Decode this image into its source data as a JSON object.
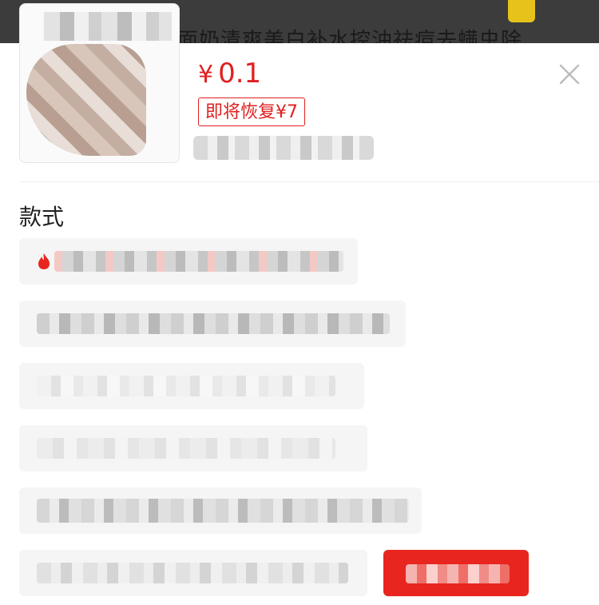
{
  "backdrop": {
    "title": "面奶清爽美白补水控油祛痘去螨虫除"
  },
  "product": {
    "price_currency": "¥",
    "price_value": "0.1",
    "restore_label": "即将恢复¥7"
  },
  "style_section": {
    "title": "款式"
  },
  "options": [
    {
      "hot": true
    },
    {
      "hot": false
    },
    {
      "hot": false
    },
    {
      "hot": false
    },
    {
      "hot": false
    },
    {
      "hot": false
    }
  ],
  "colors": {
    "accent": "#e02020",
    "buy_button": "#e8251e",
    "option_bg": "#f5f5f5"
  },
  "icons": {
    "close": "close-icon",
    "hot": "flame-icon"
  }
}
